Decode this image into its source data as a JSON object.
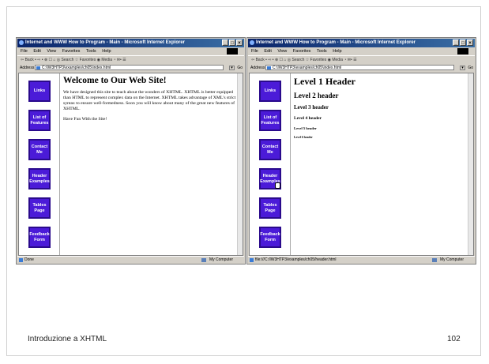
{
  "footer": {
    "left": "Introduzione a XHTML",
    "right": "102"
  },
  "browser": {
    "title": "Internet and WWW How to Program - Main - Microsoft Internet Explorer",
    "menu": [
      "File",
      "Edit",
      "View",
      "Favorites",
      "Tools",
      "Help"
    ],
    "toolbar_text": "⇦ Back • ⇨ • ⊗ ☐ ⌂  ◎ Search  ☆ Favorites  ◉ Media  ◔  ✉• ☰",
    "address_label": "Address",
    "go_label": "Go",
    "zone": "My Computer"
  },
  "left_window": {
    "address": "C:\\IW3HTP3\\examples\\ch05\\index.html",
    "status": "Done",
    "heading": "Welcome to Our Web Site!",
    "paragraph1": "We have designed this site to teach about the wonders of XHTML. XHTML is better equipped than HTML to represent complex data on the Internet. XHTML takes advantage of XML's strict syntax to ensure well-formedness. Soon you will know about many of the great new features of XHTML.",
    "paragraph2": "Have Fun With the Site!"
  },
  "right_window": {
    "address": "C:\\IW3HTP3\\examples\\ch05\\index.html",
    "status": "file:///C:/IW3HTP3/examples/ch05/header.html",
    "headers": [
      "Level 1 Header",
      "Level 2 header",
      "Level 3 header",
      "Level 4 header",
      "Level 5 header",
      "Level 6 header"
    ]
  },
  "nav_buttons": [
    {
      "line1": "Links",
      "line2": ""
    },
    {
      "line1": "List of",
      "line2": "Features"
    },
    {
      "line1": "Contact",
      "line2": "Me"
    },
    {
      "line1": "Header",
      "line2": "Examples"
    },
    {
      "line1": "Tables",
      "line2": "Page"
    },
    {
      "line1": "Feedback",
      "line2": "Form"
    }
  ]
}
